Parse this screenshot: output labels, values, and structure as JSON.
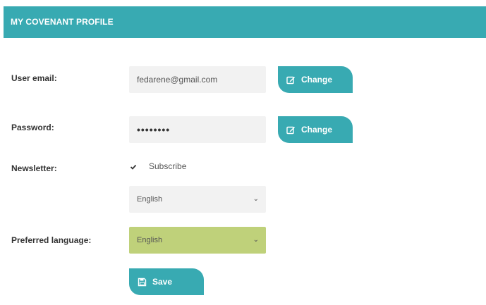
{
  "header": {
    "title": "MY COVENANT PROFILE"
  },
  "colors": {
    "accent": "#38aab2",
    "language_highlight": "#bfd17a",
    "field_bg": "#f2f2f2"
  },
  "email": {
    "label": "User email:",
    "value": "fedarene@gmail.com",
    "button_label": "Change",
    "button_icon": "edit-icon"
  },
  "password": {
    "label": "Password:",
    "value": "••••••••",
    "button_label": "Change",
    "button_icon": "edit-icon"
  },
  "newsletter": {
    "label": "Newsletter:",
    "checked": true,
    "checkbox_label": "Subscribe",
    "language_value": "English"
  },
  "preferred_language": {
    "label": "Preferred language:",
    "value": "English"
  },
  "save": {
    "label": "Save",
    "icon": "floppy-disk-icon"
  }
}
